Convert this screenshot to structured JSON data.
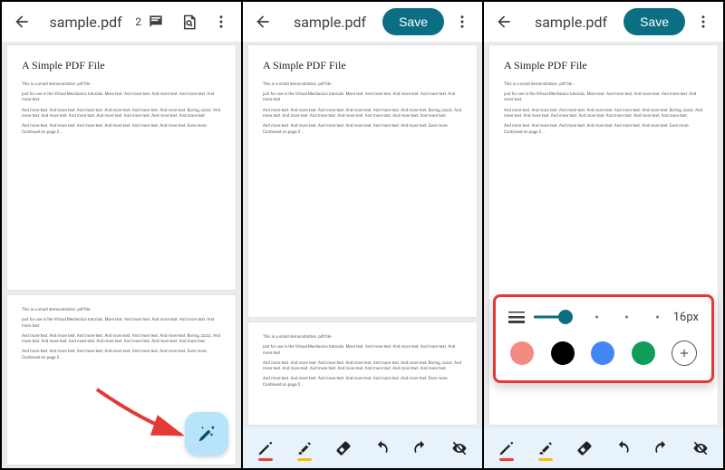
{
  "filename": "sample.pdf",
  "comment_count": "2",
  "save_label": "Save",
  "doc": {
    "title": "A Simple PDF File",
    "p1": "This is a small demonstration .pdf file -",
    "p2": "just for use in the Virtual Mechanics tutorials. More text. And more text. And more text. And more text. And more text.",
    "p3": "And more text. And more text. And more text. And more text. And more text. And more text. Boring, zzzzz. And more text. And more text. And more text. And more text. And more text. And more text. And more text.",
    "p4": "And more text. And more text. And more text. And more text. And more text. And more text. Even more. Continued on page 2 ..."
  },
  "options": {
    "size_label": "16px",
    "colors": [
      "#f28b82",
      "#000000",
      "#4285f4",
      "#0f9d58"
    ]
  },
  "tool_underlines": {
    "pen": "#ea4335",
    "highlighter": "#fbbc04"
  }
}
